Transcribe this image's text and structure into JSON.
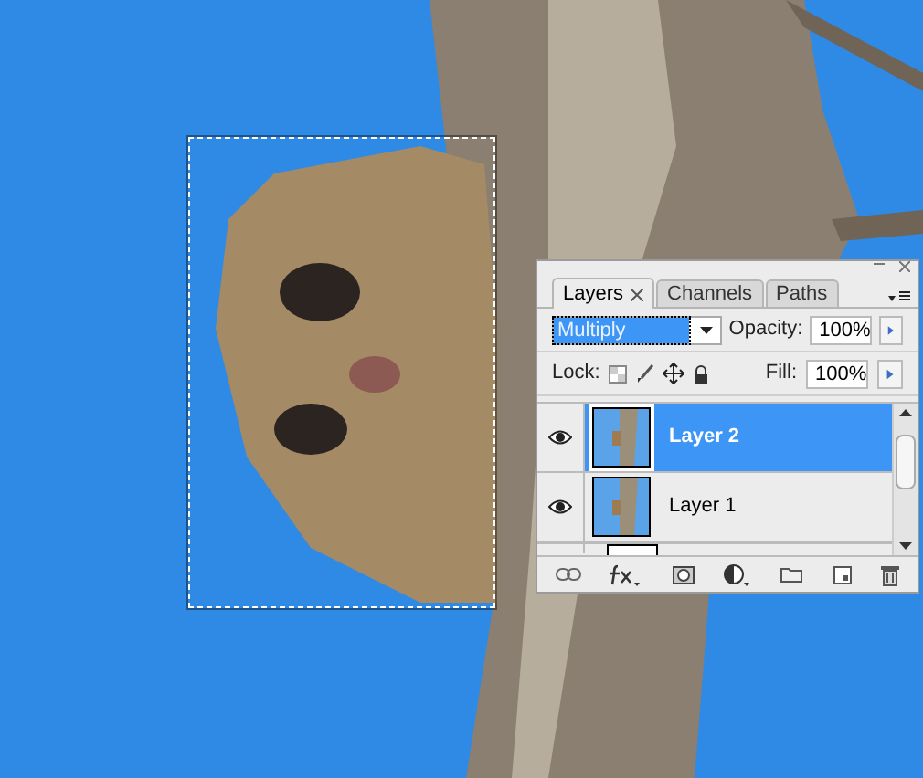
{
  "tabs": [
    {
      "label": "Layers",
      "selected": true,
      "closable": true
    },
    {
      "label": "Channels",
      "selected": false,
      "closable": false
    },
    {
      "label": "Paths",
      "selected": false,
      "closable": false
    }
  ],
  "blend_mode": {
    "value": "Multiply",
    "selected": true
  },
  "opacity": {
    "label": "Opacity:",
    "value": "100%"
  },
  "lock": {
    "label": "Lock:"
  },
  "fill": {
    "label": "Fill:",
    "value": "100%"
  },
  "layers": [
    {
      "name": "Layer 2",
      "visible": true,
      "selected": true
    },
    {
      "name": "Layer 1",
      "visible": true,
      "selected": false
    }
  ]
}
